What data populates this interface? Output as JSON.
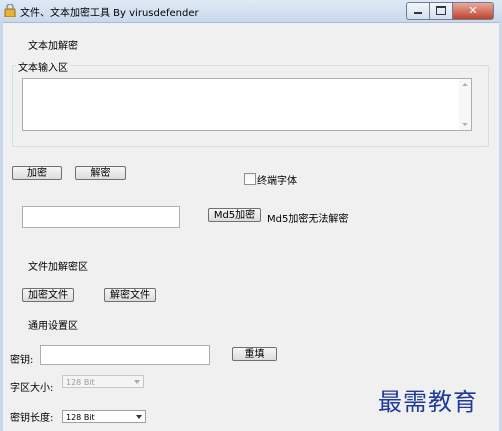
{
  "window": {
    "title": "文件、文本加密工具  By virusdefender",
    "close_glyph": "✕"
  },
  "sections": {
    "text_crypt": "文本加解密",
    "text_input_area": "文本输入区",
    "file_crypt": "文件加解密区",
    "settings": "通用设置区"
  },
  "buttons": {
    "encrypt": "加密",
    "decrypt": "解密",
    "md5_encrypt": "Md5加密",
    "encrypt_file": "加密文件",
    "decrypt_file": "解密文件",
    "reset": "重填"
  },
  "options": {
    "terminal_font": "终端字体",
    "terminal_font_checked": false
  },
  "md5": {
    "note": "Md5加密无法解密",
    "value": ""
  },
  "settings": {
    "key_label": "密钥:",
    "key_value": "",
    "block_size_label": "字区大小:",
    "block_size_value": "128 Bit",
    "key_length_label": "密钥长度:",
    "key_length_value": "128 Bit"
  },
  "text_input": {
    "value": ""
  },
  "watermark": "最需教育",
  "icons": {
    "app": "lock-icon",
    "min": "minimize-icon",
    "max": "maximize-icon",
    "close": "close-icon"
  }
}
